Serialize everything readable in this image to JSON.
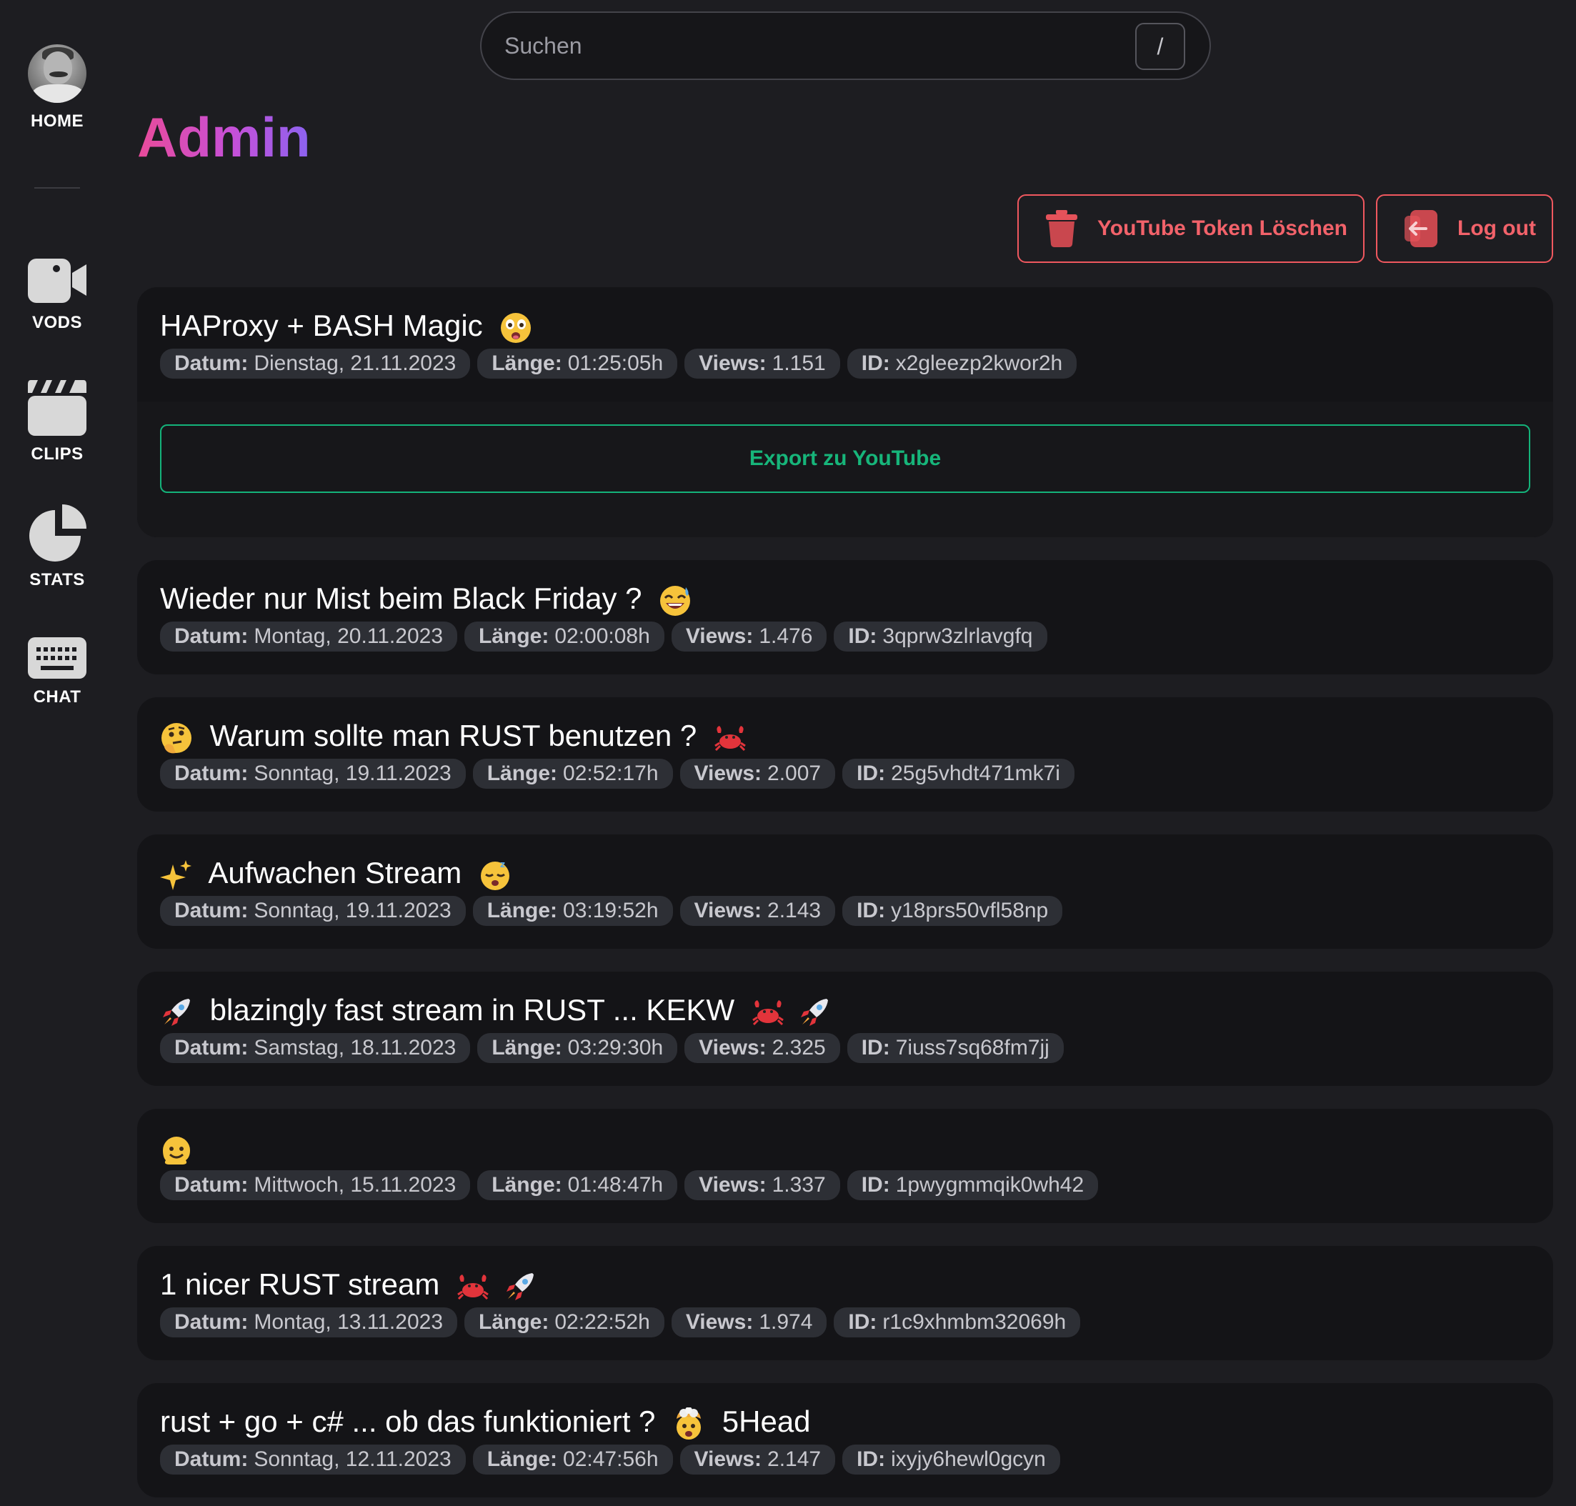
{
  "sidebar": {
    "items": [
      {
        "label": "HOME",
        "icon": "avatar"
      },
      {
        "label": "VODS",
        "icon": "video-camera-icon"
      },
      {
        "label": "CLIPS",
        "icon": "clapperboard-icon"
      },
      {
        "label": "STATS",
        "icon": "pie-chart-icon"
      },
      {
        "label": "CHAT",
        "icon": "keyboard-icon"
      }
    ]
  },
  "search": {
    "placeholder": "Suchen",
    "shortcut": "/"
  },
  "page": {
    "title": "Admin"
  },
  "actions": {
    "delete_token": "YouTube Token Löschen",
    "logout": "Log out"
  },
  "colors": {
    "export_green": "#17b57a",
    "danger_red": "#f2626a",
    "title_gradient_start": "#e94b9a",
    "title_gradient_end": "#8b63f0"
  },
  "labels": {
    "date": "Datum:",
    "length": "Länge:",
    "views": "Views:",
    "id": "ID:"
  },
  "vods": [
    {
      "title": "HAProxy + BASH Magic",
      "emoji_before": [],
      "emoji_after": [
        "astonished-face"
      ],
      "date": "Dienstag, 21.11.2023",
      "length": "01:25:05h",
      "views": "1.151",
      "id": "x2gleezp2kwor2h",
      "export_label": "Export zu YouTube"
    },
    {
      "title": "Wieder nur Mist beim Black Friday ?",
      "emoji_before": [],
      "emoji_after": [
        "sweat-smile-face"
      ],
      "date": "Montag, 20.11.2023",
      "length": "02:00:08h",
      "views": "1.476",
      "id": "3qprw3zlrlavgfq"
    },
    {
      "title": "Warum sollte man RUST benutzen ?",
      "emoji_before": [
        "thinking-face"
      ],
      "emoji_after": [
        "crab"
      ],
      "date": "Sonntag, 19.11.2023",
      "length": "02:52:17h",
      "views": "2.007",
      "id": "25g5vhdt471mk7i"
    },
    {
      "title": "Aufwachen Stream",
      "emoji_before": [
        "sparkles"
      ],
      "emoji_after": [
        "sleeping-face"
      ],
      "date": "Sonntag, 19.11.2023",
      "length": "03:19:52h",
      "views": "2.143",
      "id": "y18prs50vfl58np"
    },
    {
      "title": "blazingly fast stream in RUST ... KEKW",
      "emoji_before": [
        "rocket"
      ],
      "emoji_after": [
        "crab",
        "rocket"
      ],
      "date": "Samstag, 18.11.2023",
      "length": "03:29:30h",
      "views": "2.325",
      "id": "7iuss7sq68fm7jj"
    },
    {
      "title": "",
      "emoji_before": [
        "melting-face"
      ],
      "emoji_after": [],
      "date": "Mittwoch, 15.11.2023",
      "length": "01:48:47h",
      "views": "1.337",
      "id": "1pwygmmqik0wh42"
    },
    {
      "title": "1 nicer RUST stream",
      "emoji_before": [],
      "emoji_after": [
        "crab",
        "rocket"
      ],
      "date": "Montag, 13.11.2023",
      "length": "02:22:52h",
      "views": "1.974",
      "id": "r1c9xhmbm32069h"
    },
    {
      "title": "rust + go + c# ... ob das funktioniert ?",
      "emoji_before": [],
      "emoji_after": [
        "exploding-head"
      ],
      "title_suffix": "5Head",
      "date": "Sonntag, 12.11.2023",
      "length": "02:47:56h",
      "views": "2.147",
      "id": "ixyjy6hewl0gcyn"
    }
  ]
}
